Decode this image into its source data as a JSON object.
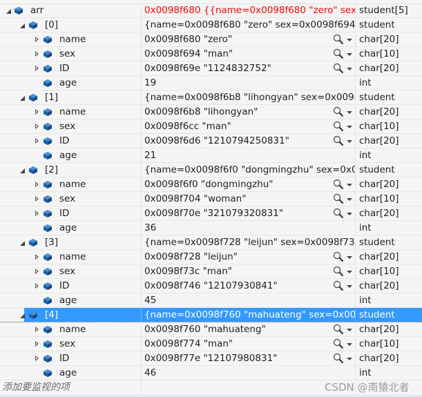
{
  "watch": {
    "rows": [
      {
        "level": 0,
        "expander": "open",
        "name": "arr",
        "value": "0x0098f680 {{name=0x0098f680 \"zero\" sex=...",
        "type": "student[5]",
        "error": true
      },
      {
        "level": 1,
        "expander": "open",
        "name": "[0]",
        "value": "{name=0x0098f680 \"zero\" sex=0x0098f694 \"...",
        "type": "student"
      },
      {
        "level": 2,
        "expander": "closed",
        "name": "name",
        "value": "0x0098f680 \"zero\"",
        "type": "char[20]",
        "visualizer": true
      },
      {
        "level": 2,
        "expander": "closed",
        "name": "sex",
        "value": "0x0098f694 \"man\"",
        "type": "char[10]",
        "visualizer": true
      },
      {
        "level": 2,
        "expander": "closed",
        "name": "ID",
        "value": "0x0098f69e \"1124832752\"",
        "type": "char[20]",
        "visualizer": true
      },
      {
        "level": 2,
        "expander": "none",
        "name": "age",
        "value": "19",
        "type": "int"
      },
      {
        "level": 1,
        "expander": "open",
        "name": "[1]",
        "value": "{name=0x0098f6b8 \"lihongyan\" sex=0x0098f...",
        "type": "student"
      },
      {
        "level": 2,
        "expander": "closed",
        "name": "name",
        "value": "0x0098f6b8 \"lihongyan\"",
        "type": "char[20]",
        "visualizer": true
      },
      {
        "level": 2,
        "expander": "closed",
        "name": "sex",
        "value": "0x0098f6cc \"man\"",
        "type": "char[10]",
        "visualizer": true
      },
      {
        "level": 2,
        "expander": "closed",
        "name": "ID",
        "value": "0x0098f6d6 \"1210794250831\"",
        "type": "char[20]",
        "visualizer": true
      },
      {
        "level": 2,
        "expander": "none",
        "name": "age",
        "value": "21",
        "type": "int"
      },
      {
        "level": 1,
        "expander": "open",
        "name": "[2]",
        "value": "{name=0x0098f6f0 \"dongmingzhu\" sex=0x0...",
        "type": "student"
      },
      {
        "level": 2,
        "expander": "closed",
        "name": "name",
        "value": "0x0098f6f0 \"dongmingzhu\"",
        "type": "char[20]",
        "visualizer": true
      },
      {
        "level": 2,
        "expander": "closed",
        "name": "sex",
        "value": "0x0098f704 \"woman\"",
        "type": "char[10]",
        "visualizer": true
      },
      {
        "level": 2,
        "expander": "closed",
        "name": "ID",
        "value": "0x0098f70e \"321079320831\"",
        "type": "char[20]",
        "visualizer": true
      },
      {
        "level": 2,
        "expander": "none",
        "name": "age",
        "value": "36",
        "type": "int"
      },
      {
        "level": 1,
        "expander": "open",
        "name": "[3]",
        "value": "{name=0x0098f728 \"leijun\" sex=0x0098f73c ...",
        "type": "student"
      },
      {
        "level": 2,
        "expander": "closed",
        "name": "name",
        "value": "0x0098f728 \"leijun\"",
        "type": "char[20]",
        "visualizer": true
      },
      {
        "level": 2,
        "expander": "closed",
        "name": "sex",
        "value": "0x0098f73c \"man\"",
        "type": "char[10]",
        "visualizer": true
      },
      {
        "level": 2,
        "expander": "closed",
        "name": "ID",
        "value": "0x0098f746 \"12107930841\"",
        "type": "char[20]",
        "visualizer": true
      },
      {
        "level": 2,
        "expander": "none",
        "name": "age",
        "value": "45",
        "type": "int"
      },
      {
        "level": 1,
        "expander": "open",
        "name": "[4]",
        "value": "{name=0x0098f760 \"mahuateng\" sex=0x009...",
        "type": "student",
        "selected": true
      },
      {
        "level": 2,
        "expander": "closed",
        "name": "name",
        "value": "0x0098f760 \"mahuateng\"",
        "type": "char[20]",
        "visualizer": true
      },
      {
        "level": 2,
        "expander": "closed",
        "name": "sex",
        "value": "0x0098f774 \"man\"",
        "type": "char[10]",
        "visualizer": true
      },
      {
        "level": 2,
        "expander": "closed",
        "name": "ID",
        "value": "0x0098f77e \"12107980831\"",
        "type": "char[20]",
        "visualizer": true
      },
      {
        "level": 2,
        "expander": "none",
        "name": "age",
        "value": "46",
        "type": "int"
      }
    ],
    "add_item_placeholder": "添加要监视的项",
    "watermark": "CSDN @南猿北者"
  },
  "colors": {
    "selection": "#3399ff",
    "error_value": "#ff0000",
    "icon": "#1e5fa8"
  }
}
